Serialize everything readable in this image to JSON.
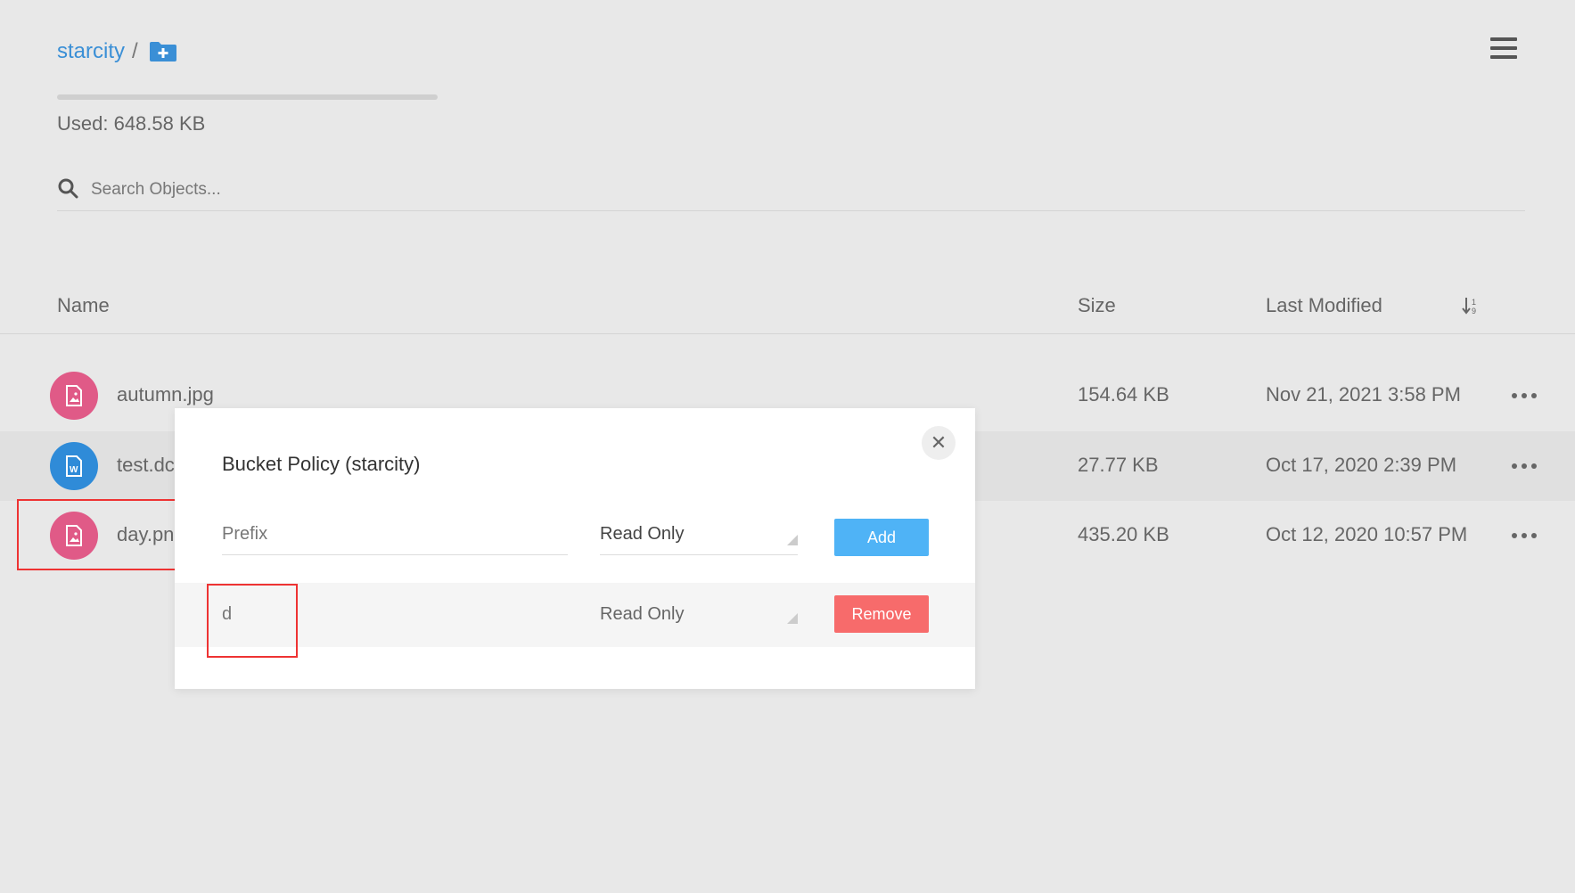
{
  "breadcrumb": {
    "bucket": "starcity",
    "separator": "/",
    "add_folder_icon": "folder-plus-icon"
  },
  "menu_icon": "hamburger-icon",
  "usage": {
    "used_label": "Used: 648.58 KB"
  },
  "search": {
    "placeholder": "Search Objects...",
    "icon": "search-icon"
  },
  "table": {
    "headers": {
      "name": "Name",
      "size": "Size",
      "modified": "Last Modified",
      "sort_icon": "sort-icon"
    },
    "rows": [
      {
        "name": "autumn.jpg",
        "size": "154.64 KB",
        "modified": "Nov 21, 2021 3:58 PM",
        "icon": "image-file-icon",
        "color": "#e05a87"
      },
      {
        "name": "test.dc",
        "size": "27.77 KB",
        "modified": "Oct 17, 2020 2:39 PM",
        "icon": "word-file-icon",
        "color": "#2f8bd8"
      },
      {
        "name": "day.pn",
        "size": "435.20 KB",
        "modified": "Oct 12, 2020 10:57 PM",
        "icon": "image-file-icon",
        "color": "#e05a87"
      }
    ]
  },
  "modal": {
    "title": "Bucket Policy (starcity)",
    "close_icon": "close-icon",
    "new_policy": {
      "prefix_placeholder": "Prefix",
      "access": "Read Only",
      "add_label": "Add"
    },
    "policies": [
      {
        "prefix": "d",
        "access": "Read Only",
        "remove_label": "Remove"
      }
    ]
  },
  "colors": {
    "link": "#3a8fd6",
    "add_button": "#4fb3f6",
    "remove_button": "#f76b6b",
    "highlight": "#e33333"
  }
}
